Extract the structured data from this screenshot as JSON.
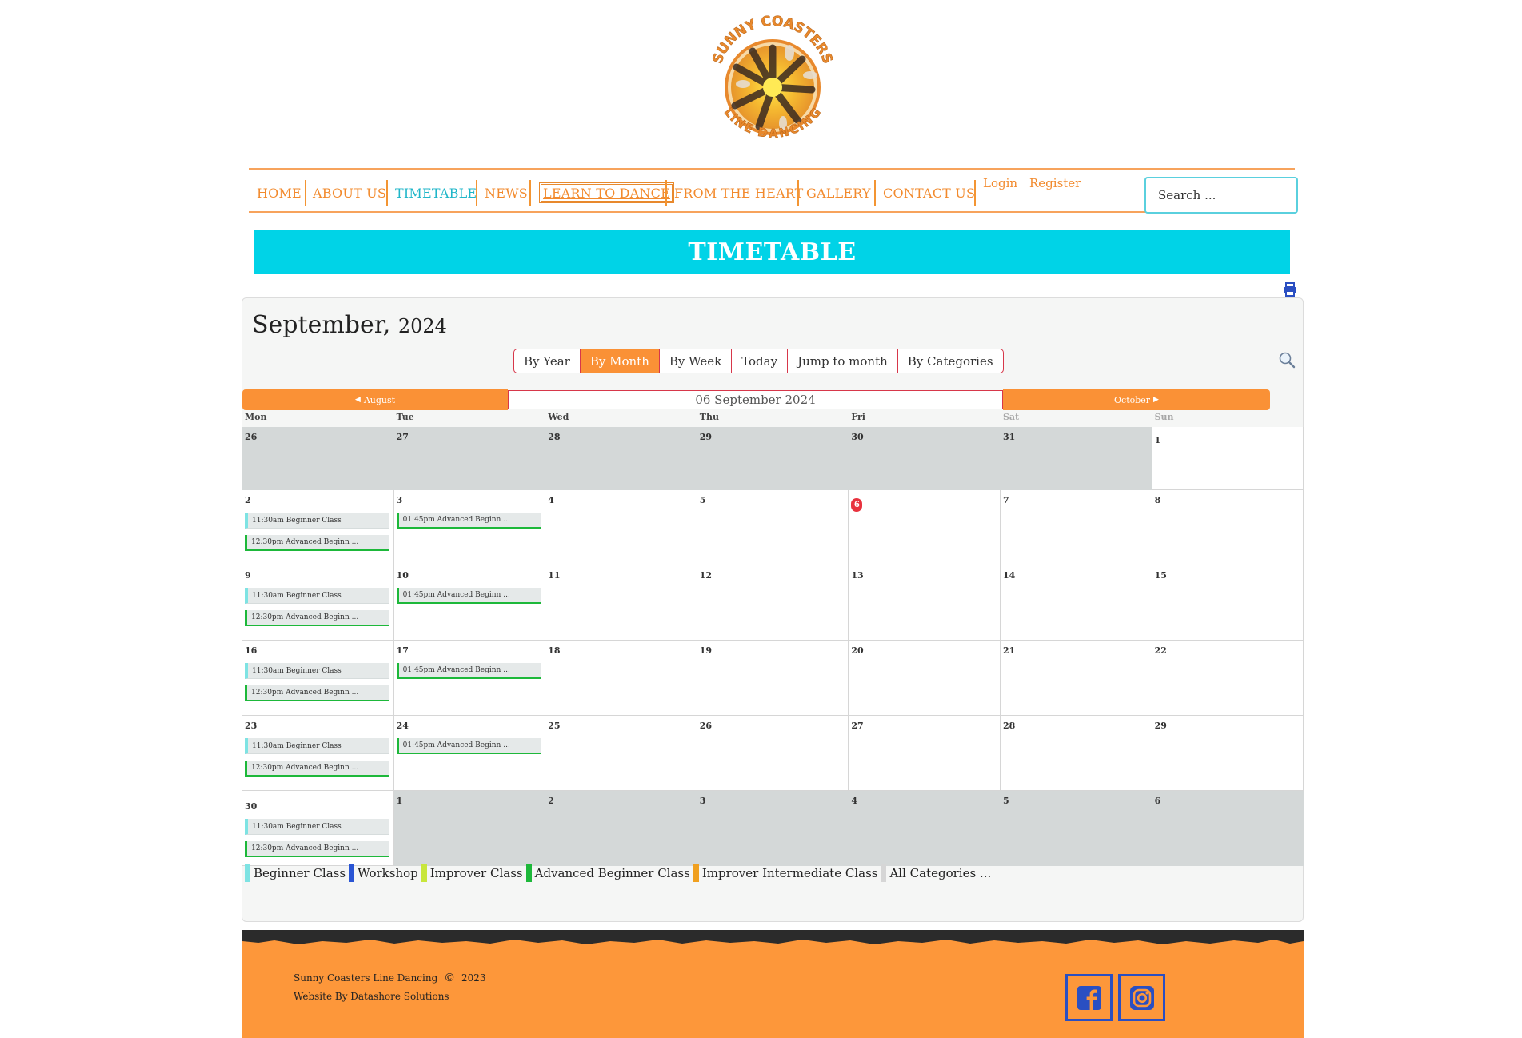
{
  "logo": {
    "text_top": "SUNNY COASTERS",
    "text_bottom": "LINE DANCING"
  },
  "nav": {
    "items": [
      {
        "label": "HOME"
      },
      {
        "label": "ABOUT US"
      },
      {
        "label": "TIMETABLE"
      },
      {
        "label": "NEWS"
      },
      {
        "label": "LEARN TO DANCE"
      },
      {
        "label": "FROM THE HEART"
      },
      {
        "label": "GALLERY"
      },
      {
        "label": "CONTACT US"
      }
    ],
    "login": "Login",
    "register": "Register",
    "search_placeholder": "Search ..."
  },
  "banner": {
    "title": "TIMETABLE"
  },
  "calendar": {
    "month": "September,",
    "year": "2024",
    "views": [
      "By Year",
      "By Month",
      "By Week",
      "Today",
      "Jump to month",
      "By Categories"
    ],
    "prev_label": "August",
    "next_label": "October",
    "current_date": "06 September 2024",
    "weekdays": [
      "Mon",
      "Tue",
      "Wed",
      "Thu",
      "Fri",
      "Sat",
      "Sun"
    ],
    "weeks": [
      [
        {
          "day": "26",
          "out": true
        },
        {
          "day": "27",
          "out": true
        },
        {
          "day": "28",
          "out": true
        },
        {
          "day": "29",
          "out": true
        },
        {
          "day": "30",
          "out": true
        },
        {
          "day": "31",
          "out": true
        },
        {
          "day": "1"
        }
      ],
      [
        {
          "day": "2",
          "events": [
            {
              "text": "11:30am Beginner Class",
              "cat": "beginner"
            },
            {
              "text": "12:30pm Advanced Beginn ...",
              "cat": "advanced"
            }
          ]
        },
        {
          "day": "3",
          "events": [
            {
              "text": "01:45pm Advanced Beginn ...",
              "cat": "advanced"
            }
          ]
        },
        {
          "day": "4"
        },
        {
          "day": "5"
        },
        {
          "day": "6",
          "today": true
        },
        {
          "day": "7"
        },
        {
          "day": "8"
        }
      ],
      [
        {
          "day": "9",
          "events": [
            {
              "text": "11:30am Beginner Class",
              "cat": "beginner"
            },
            {
              "text": "12:30pm Advanced Beginn ...",
              "cat": "advanced"
            }
          ]
        },
        {
          "day": "10",
          "events": [
            {
              "text": "01:45pm Advanced Beginn ...",
              "cat": "advanced"
            }
          ]
        },
        {
          "day": "11"
        },
        {
          "day": "12"
        },
        {
          "day": "13"
        },
        {
          "day": "14"
        },
        {
          "day": "15"
        }
      ],
      [
        {
          "day": "16",
          "events": [
            {
              "text": "11:30am Beginner Class",
              "cat": "beginner"
            },
            {
              "text": "12:30pm Advanced Beginn ...",
              "cat": "advanced"
            }
          ]
        },
        {
          "day": "17",
          "events": [
            {
              "text": "01:45pm Advanced Beginn ...",
              "cat": "advanced"
            }
          ]
        },
        {
          "day": "18"
        },
        {
          "day": "19"
        },
        {
          "day": "20"
        },
        {
          "day": "21"
        },
        {
          "day": "22"
        }
      ],
      [
        {
          "day": "23",
          "events": [
            {
              "text": "11:30am Beginner Class",
              "cat": "beginner"
            },
            {
              "text": "12:30pm Advanced Beginn ...",
              "cat": "advanced"
            }
          ]
        },
        {
          "day": "24",
          "events": [
            {
              "text": "01:45pm Advanced Beginn ...",
              "cat": "advanced"
            }
          ]
        },
        {
          "day": "25"
        },
        {
          "day": "26"
        },
        {
          "day": "27"
        },
        {
          "day": "28"
        },
        {
          "day": "29"
        }
      ],
      [
        {
          "day": "30",
          "events": [
            {
              "text": "11:30am Beginner Class",
              "cat": "beginner"
            },
            {
              "text": "12:30pm Advanced Beginn ...",
              "cat": "advanced"
            }
          ]
        },
        {
          "day": "1",
          "out": true
        },
        {
          "day": "2",
          "out": true
        },
        {
          "day": "3",
          "out": true
        },
        {
          "day": "4",
          "out": true
        },
        {
          "day": "5",
          "out": true
        },
        {
          "day": "6",
          "out": true
        }
      ]
    ],
    "legend": [
      {
        "label": "Beginner Class",
        "color": "#7ee3e3"
      },
      {
        "label": "Workshop",
        "color": "#2a55d4"
      },
      {
        "label": "Improver Class",
        "color": "#c8e63c"
      },
      {
        "label": "Advanced Beginner Class",
        "color": "#1db83a"
      },
      {
        "label": "Improver Intermediate Class",
        "color": "#f0a020"
      },
      {
        "label": "All Categories ...",
        "color": "#d6d6d6"
      }
    ]
  },
  "footer": {
    "copyright_name": "Sunny Coasters Line Dancing",
    "copyright_symbol": "©",
    "copyright_year": "2023",
    "credit": "Website By Datashore Solutions",
    "social": [
      {
        "name": "facebook"
      },
      {
        "name": "instagram"
      }
    ]
  },
  "colors": {
    "accent": "#fa9136",
    "teal": "#00d3e7",
    "nav_text": "#f28a2d",
    "social": "#2a4fc2"
  }
}
